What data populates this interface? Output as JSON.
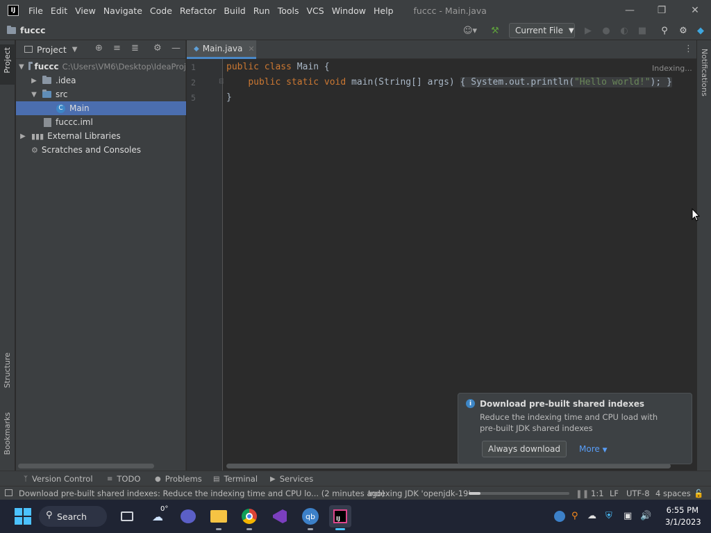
{
  "titlebar": {
    "menu": [
      "File",
      "Edit",
      "View",
      "Navigate",
      "Code",
      "Refactor",
      "Build",
      "Run",
      "Tools",
      "VCS",
      "Window",
      "Help"
    ],
    "window_title": "fuccc - Main.java"
  },
  "navbar": {
    "project_name": "fuccc",
    "run_config": "Current File"
  },
  "left_strip": {
    "project_label": "Project",
    "structure_label": "Structure",
    "bookmarks_label": "Bookmarks"
  },
  "right_strip": {
    "notifications_label": "Notifications"
  },
  "project_panel": {
    "title": "Project",
    "tree": [
      {
        "name": "fuccc",
        "path": "C:\\Users\\VM6\\Desktop\\IdeaProj"
      },
      {
        "name": ".idea"
      },
      {
        "name": "src"
      },
      {
        "name": "Main"
      },
      {
        "name": "fuccc.iml"
      },
      {
        "name": "External Libraries"
      },
      {
        "name": "Scratches and Consoles"
      }
    ]
  },
  "editor": {
    "tab_label": "Main.java",
    "indexing_label": "Indexing...",
    "line_numbers": [
      "1",
      "2",
      "5"
    ],
    "code": {
      "l1_kw1": "public",
      "l1_kw2": "class",
      "l1_rest": " Main {",
      "l2_kw1": "public",
      "l2_kw2": "static",
      "l2_kw3": "void",
      "l2_sig": " main(String[] args) ",
      "l2_body_pre": "{ System.out.println(",
      "l2_str": "\"Hello world!\"",
      "l2_body_post": "); }",
      "l3": "}"
    }
  },
  "notification": {
    "title": "Download pre-built shared indexes",
    "body_line1": "Reduce the indexing time and CPU load with",
    "body_line2": "pre-built JDK shared indexes",
    "primary_button": "Always download",
    "more_link": "More"
  },
  "tool_windows": [
    "Version Control",
    "TODO",
    "Problems",
    "Terminal",
    "Services"
  ],
  "statusbar": {
    "message": "Download pre-built shared indexes: Reduce the indexing time and CPU lo... (2 minutes ago)",
    "indexing": "Indexing JDK 'openjdk-19'",
    "indexing_progress": 0.12,
    "position": "1:1",
    "line_sep": "LF",
    "encoding": "UTF-8",
    "indent": "4 spaces"
  },
  "taskbar": {
    "search_label": "Search",
    "weather": "0°",
    "time": "6:55 PM",
    "date": "3/1/2023",
    "colors": {
      "accent": "#4a88c7",
      "selection": "#4b6eaf",
      "keyword": "#cc7832",
      "string": "#6a8759"
    }
  }
}
